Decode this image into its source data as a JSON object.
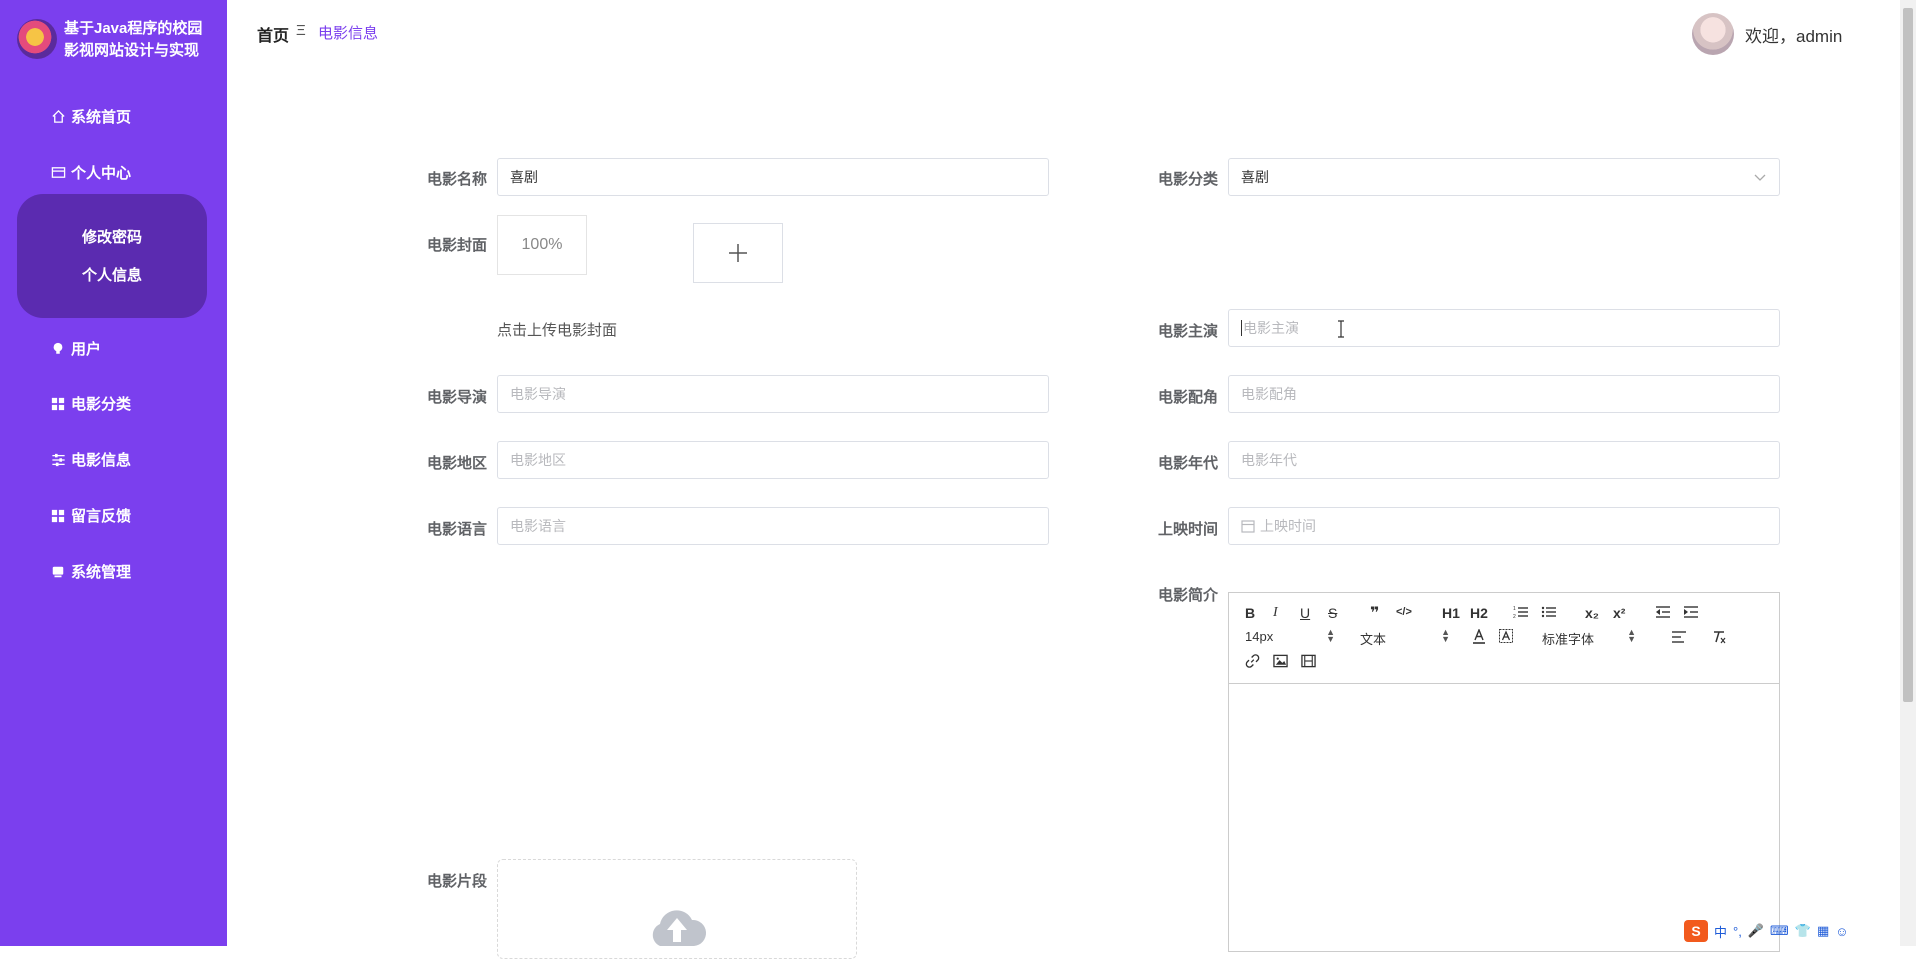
{
  "site": {
    "title": "基于Java程序的校园影视网站设计与实现"
  },
  "menu": [
    {
      "label": "系统首页",
      "icon": "home-icon"
    },
    {
      "label": "个人中心",
      "icon": "card-icon"
    },
    {
      "label": "用户",
      "icon": "bulb-icon"
    },
    {
      "label": "电影分类",
      "icon": "grid-icon"
    },
    {
      "label": "电影信息",
      "icon": "sliders-icon"
    },
    {
      "label": "留言反馈",
      "icon": "grid-icon"
    },
    {
      "label": "系统管理",
      "icon": "monitor-icon"
    }
  ],
  "submenu": [
    {
      "label": "修改密码"
    },
    {
      "label": "个人信息"
    }
  ],
  "header": {
    "breadcrumb_home": "首页",
    "breadcrumb_sep": "Ξ",
    "breadcrumb_current": "电影信息",
    "welcome": "欢迎，admin"
  },
  "form": {
    "name_label": "电影名称",
    "name_value": "喜剧",
    "category_label": "电影分类",
    "category_value": "喜剧",
    "cover_label": "电影封面",
    "cover_zoom": "100%",
    "cover_hint": "点击上传电影封面",
    "lead_label": "电影主演",
    "lead_placeholder": "电影主演",
    "director_label": "电影导演",
    "director_placeholder": "电影导演",
    "support_label": "电影配角",
    "support_placeholder": "电影配角",
    "region_label": "电影地区",
    "region_placeholder": "电影地区",
    "year_label": "电影年代",
    "year_placeholder": "电影年代",
    "language_label": "电影语言",
    "language_placeholder": "电影语言",
    "release_label": "上映时间",
    "release_placeholder": "上映时间",
    "intro_label": "电影简介",
    "clip_label": "电影片段"
  },
  "editor": {
    "font_size": "14px",
    "block_type": "文本",
    "font_family": "标准字体",
    "buttons": [
      "B",
      "I",
      "U",
      "S",
      "❞",
      "</>",
      "H1",
      "H2",
      "ordered-list",
      "bullet-list",
      "x₂",
      "x²",
      "outdent",
      "indent",
      "font-color",
      "background-color",
      "align",
      "clear-format",
      "link",
      "image",
      "video"
    ]
  },
  "ime": {
    "lang": "中",
    "punct": "°,"
  }
}
